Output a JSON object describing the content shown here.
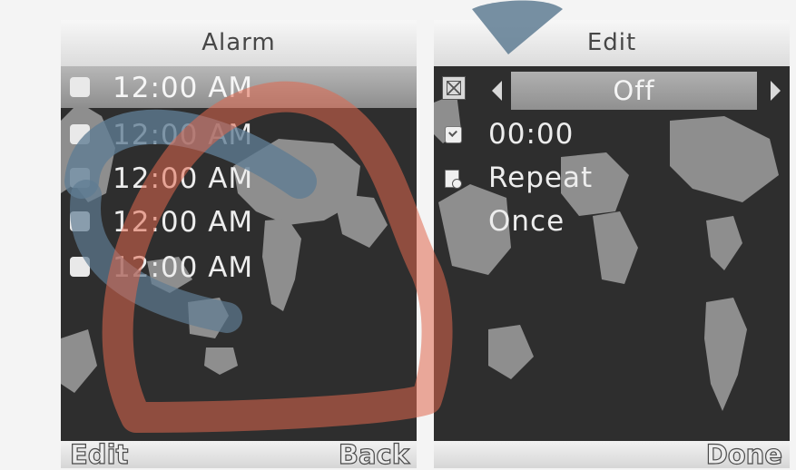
{
  "alarm_screen": {
    "title": "Alarm",
    "alarms": [
      {
        "time": "12:00 AM",
        "selected": true
      },
      {
        "time": "12:00 AM",
        "selected": false
      },
      {
        "time": "12:00 AM",
        "selected": false
      },
      {
        "time": "12:00 AM",
        "selected": false
      },
      {
        "time": "12:00 AM",
        "selected": false
      }
    ],
    "softkeys": {
      "left": "Edit",
      "right": "Back"
    }
  },
  "edit_screen": {
    "title": "Edit",
    "status_value": "Off",
    "time_value": "00:00",
    "repeat_label": "Repeat",
    "repeat_value": "Once",
    "softkeys": {
      "right": "Done"
    }
  },
  "colors": {
    "background": "#f4f4f4",
    "screen_background": "#2e2e2e",
    "map_land": "#8e8e8e",
    "selection": "#a3a3a3",
    "text": "#ededed",
    "watermark_blue": "#5f7c93",
    "watermark_red": "#e0674e"
  },
  "icons": {
    "status_checkbox": "checkbox-cross-icon",
    "time_row": "clock-check-icon",
    "repeat_row": "repeat-page-icon",
    "left_arrow": "arrow-left-icon",
    "right_arrow": "arrow-right-icon"
  }
}
